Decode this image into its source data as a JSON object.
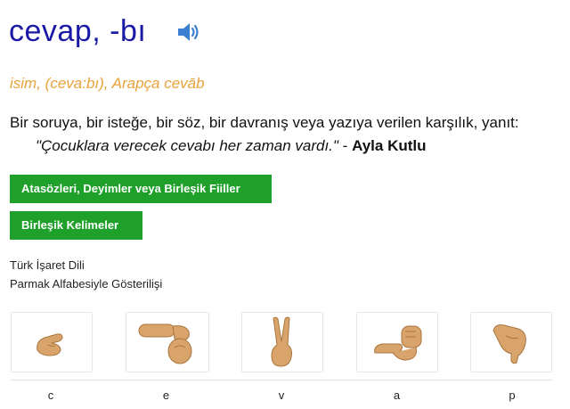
{
  "entry": {
    "word": "cevap, -bı",
    "pos_line": "isim, (ceva:bı), Arapça cevāb",
    "definition": "Bir soruya, bir isteğe, bir söz, bir davranış veya yazıya verilen karşılık, yanıt:",
    "example_quote": "\"Çocuklara verecek cevabı her zaman vardı.\"",
    "example_sep": " - ",
    "example_author": "Ayla Kutlu"
  },
  "buttons": {
    "idioms": "Atasözleri, Deyimler veya Birleşik Fiiller",
    "compounds": "Birleşik Kelimeler"
  },
  "sign": {
    "line1": "Türk İşaret Dili",
    "line2": "Parmak Alfabesiyle Gösterilişi",
    "letters": [
      "c",
      "e",
      "v",
      "a",
      "p"
    ]
  },
  "icons": {
    "speaker": "speaker-icon",
    "hand": "hand-sign-icon"
  },
  "colors": {
    "title": "#1a1aa6",
    "pos": "#e8a23a",
    "button": "#1fa02b",
    "skin": "#d9a46c"
  }
}
